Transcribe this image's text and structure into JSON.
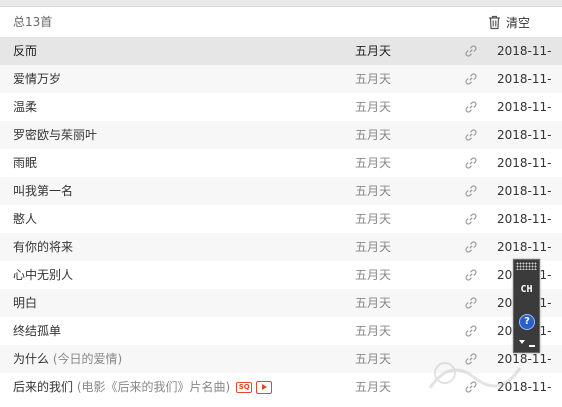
{
  "header": {
    "count_text": "总13首",
    "clear_label": "清空",
    "clear_icon": "trash-icon"
  },
  "songs": [
    {
      "title": "反而",
      "subtitle": "",
      "artist": "五月天",
      "date": "2018-11-",
      "selected": true
    },
    {
      "title": "爱情万岁",
      "subtitle": "",
      "artist": "五月天",
      "date": "2018-11-"
    },
    {
      "title": "温柔",
      "subtitle": "",
      "artist": "五月天",
      "date": "2018-11-"
    },
    {
      "title": "罗密欧与茱丽叶",
      "subtitle": "",
      "artist": "五月天",
      "date": "2018-11-"
    },
    {
      "title": "雨眠",
      "subtitle": "",
      "artist": "五月天",
      "date": "2018-11-"
    },
    {
      "title": "叫我第一名",
      "subtitle": "",
      "artist": "五月天",
      "date": "2018-11-"
    },
    {
      "title": "憨人",
      "subtitle": "",
      "artist": "五月天",
      "date": "2018-11-"
    },
    {
      "title": "有你的将来",
      "subtitle": "",
      "artist": "五月天",
      "date": "2018-11-"
    },
    {
      "title": "心中无别人",
      "subtitle": "",
      "artist": "五月天",
      "date": "2018-11-"
    },
    {
      "title": "明白",
      "subtitle": "",
      "artist": "五月天",
      "date": "2018-11-"
    },
    {
      "title": "终结孤单",
      "subtitle": "",
      "artist": "五月天",
      "date": "2018-11-"
    },
    {
      "title": "为什么",
      "subtitle": "(今日的爱情)",
      "artist": "五月天",
      "date": "2018-11-"
    },
    {
      "title": "后来的我们",
      "subtitle": "(电影《后来的我们》片名曲)",
      "artist": "五月天",
      "date": "2018-11-",
      "badges": [
        "SQ",
        "MV"
      ]
    }
  ],
  "ime": {
    "lang": "CH",
    "help": "?"
  },
  "colors": {
    "selected_row": "#e6e6e6",
    "stripe_row": "#f7f7f7",
    "badge_red": "#e04a2a"
  }
}
